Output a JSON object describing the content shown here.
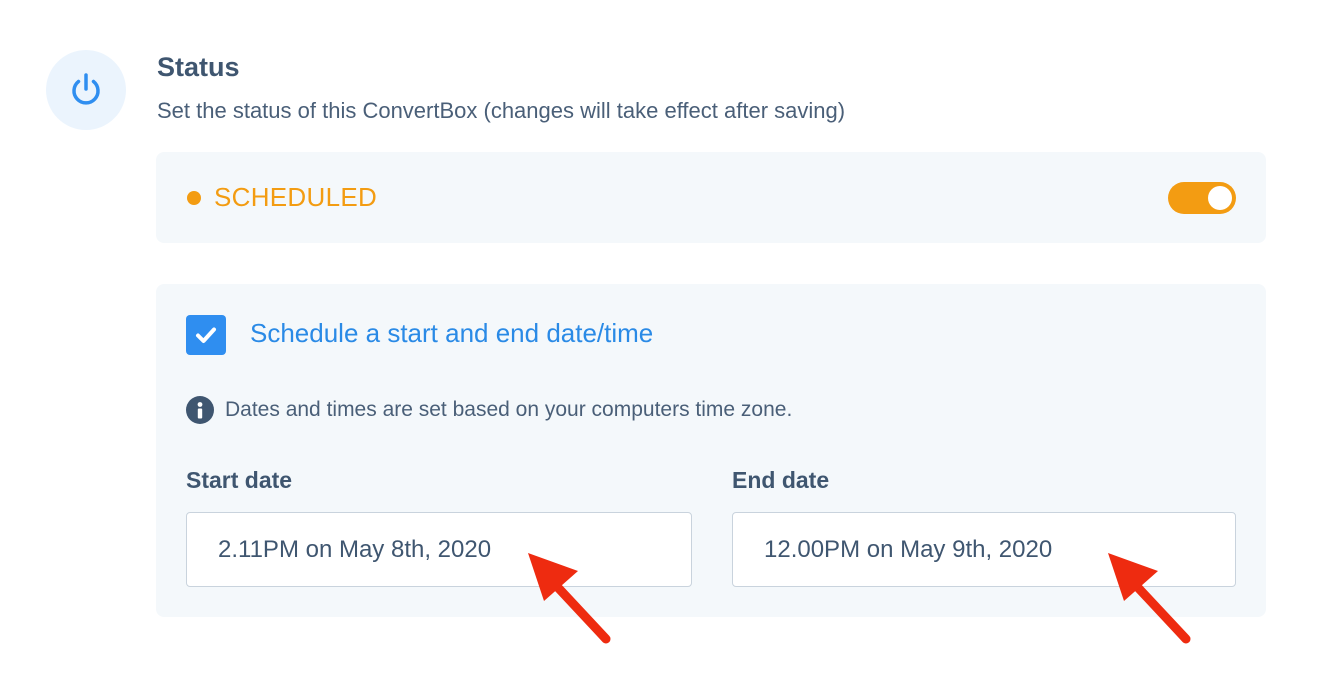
{
  "section": {
    "title": "Status",
    "subtitle": "Set the status of this ConvertBox (changes will take effect after saving)",
    "icon": "power-icon"
  },
  "status": {
    "label": "SCHEDULED",
    "color": "#f39c12",
    "toggle_on": true
  },
  "schedule": {
    "checkbox_checked": true,
    "checkbox_label": "Schedule a start and end date/time",
    "info_text": "Dates and times are set based on your computers time zone.",
    "start": {
      "label": "Start date",
      "value": "2.11PM on May 8th, 2020"
    },
    "end": {
      "label": "End date",
      "value": "12.00PM on May 9th, 2020"
    }
  },
  "colors": {
    "accent_blue": "#2f8ef0",
    "text_dark": "#3f5670",
    "card_bg": "#f4f8fb",
    "annotation_arrow": "#ee2b10"
  }
}
